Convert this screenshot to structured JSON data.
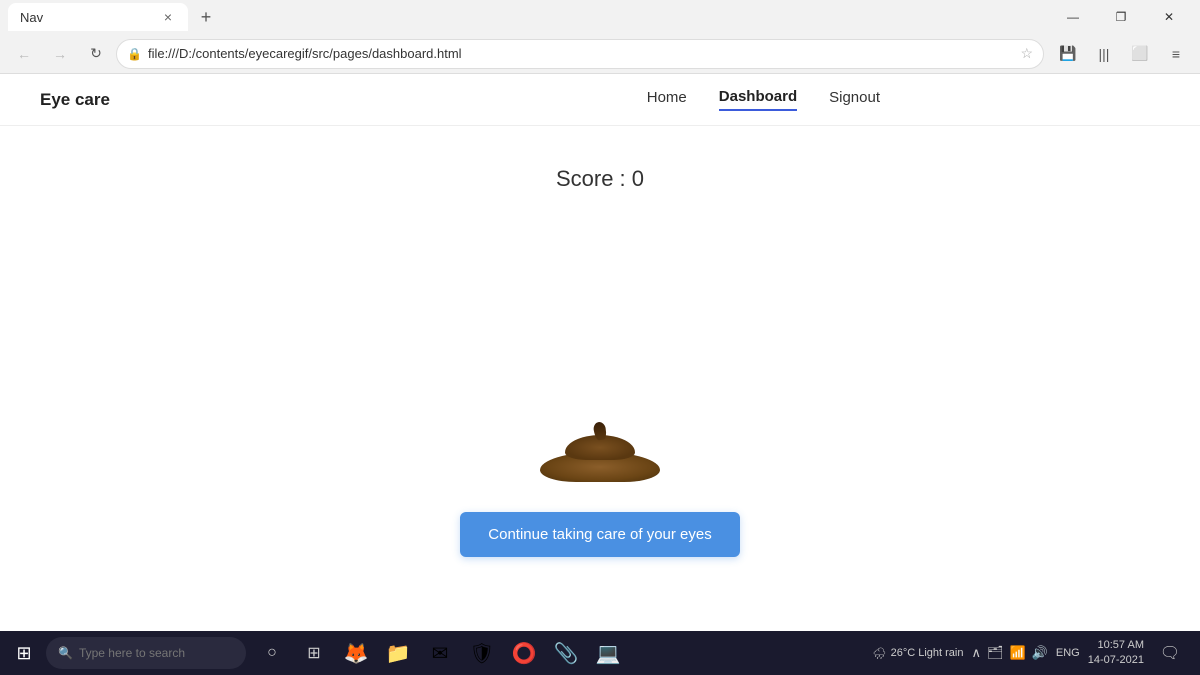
{
  "browser": {
    "tab_title": "Nav",
    "tab_close": "×",
    "new_tab": "+",
    "address": "file:///D:/contents/eyecaregif/src/pages/dashboard.html",
    "address_icon": "🔒",
    "star_icon": "☆",
    "win_minimize": "—",
    "win_restore": "❐",
    "win_close": "✕",
    "back_icon": "←",
    "forward_icon": "→",
    "refresh_icon": "↻",
    "toolbar_icons": [
      "💾",
      "|||",
      "⬜",
      "≡"
    ]
  },
  "navbar": {
    "brand": "Eye care",
    "links": [
      {
        "label": "Home",
        "active": false
      },
      {
        "label": "Dashboard",
        "active": true
      },
      {
        "label": "Signout",
        "active": false
      }
    ]
  },
  "main": {
    "score_label": "Score : 0",
    "continue_button": "Continue taking care of your eyes"
  },
  "taskbar": {
    "start_icon": "⊞",
    "search_placeholder": "Type here to search",
    "search_icon": "🔍",
    "apps": [
      "○",
      "⊞",
      "🦊",
      "📁",
      "✉",
      "🛡",
      "⭕",
      "📎",
      "💻"
    ],
    "weather": "26°C Light rain",
    "weather_icon": "🌧",
    "tray_icons": [
      "^",
      "🗂",
      "📶",
      "🔊"
    ],
    "lang": "ENG",
    "time": "10:57 AM",
    "date": "14-07-2021",
    "notification_icon": "🗨"
  }
}
